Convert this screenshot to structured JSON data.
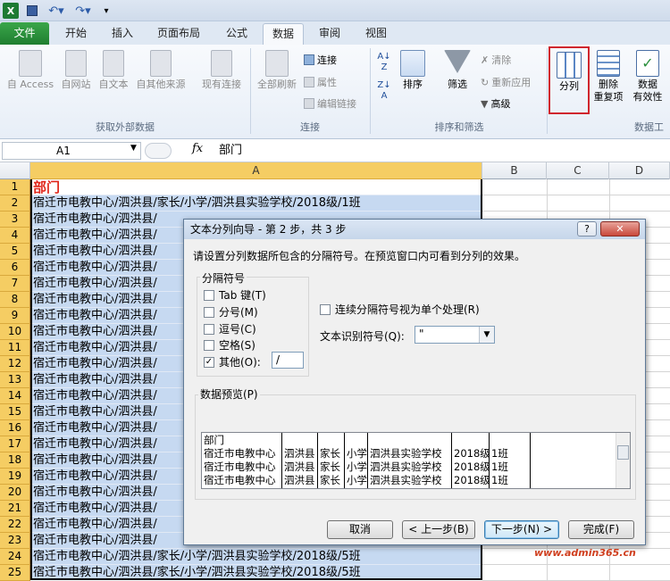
{
  "ribbon": {
    "tabs": [
      {
        "label": "文件"
      },
      {
        "label": "开始"
      },
      {
        "label": "插入"
      },
      {
        "label": "页面布局"
      },
      {
        "label": "公式"
      },
      {
        "label": "数据"
      },
      {
        "label": "审阅"
      },
      {
        "label": "视图"
      }
    ],
    "active_tab": "数据",
    "groups": {
      "external": {
        "label": "获取外部数据",
        "access": "自 Access",
        "web": "自网站",
        "text": "自文本",
        "other": "自其他来源",
        "existing": "现有连接"
      },
      "connections": {
        "label": "连接",
        "refresh_all": "全部刷新",
        "connections": "连接",
        "properties": "属性",
        "edit_links": "编辑链接"
      },
      "sort_filter": {
        "label": "排序和筛选",
        "sort": "排序",
        "filter": "筛选",
        "clear": "清除",
        "reapply": "重新应用",
        "advanced": "高级"
      },
      "data_tools": {
        "label": "数据工",
        "text_to_columns": "分列",
        "remove_dup_1": "删除",
        "remove_dup_2": "重复项",
        "validation_1": "数据",
        "validation_2": "有效性"
      }
    }
  },
  "formula_bar": {
    "name_box": "A1",
    "fx": "fx",
    "content": "部门"
  },
  "columns": [
    "A",
    "B",
    "C",
    "D"
  ],
  "rows": {
    "numbers": [
      "1",
      "2",
      "3",
      "4",
      "5",
      "6",
      "7",
      "8",
      "9",
      "10",
      "11",
      "12",
      "13",
      "14",
      "15",
      "16",
      "17",
      "18",
      "19",
      "20",
      "21",
      "22",
      "23",
      "24",
      "25"
    ],
    "a_values": [
      "部门",
      "宿迁市电教中心/泗洪县/家长/小学/泗洪县实验学校/2018级/1班",
      "宿迁市电教中心/泗洪县/",
      "宿迁市电教中心/泗洪县/",
      "宿迁市电教中心/泗洪县/",
      "宿迁市电教中心/泗洪县/",
      "宿迁市电教中心/泗洪县/",
      "宿迁市电教中心/泗洪县/",
      "宿迁市电教中心/泗洪县/",
      "宿迁市电教中心/泗洪县/",
      "宿迁市电教中心/泗洪县/",
      "宿迁市电教中心/泗洪县/",
      "宿迁市电教中心/泗洪县/",
      "宿迁市电教中心/泗洪县/",
      "宿迁市电教中心/泗洪县/",
      "宿迁市电教中心/泗洪县/",
      "宿迁市电教中心/泗洪县/",
      "宿迁市电教中心/泗洪县/",
      "宿迁市电教中心/泗洪县/",
      "宿迁市电教中心/泗洪县/",
      "宿迁市电教中心/泗洪县/",
      "宿迁市电教中心/泗洪县/",
      "宿迁市电教中心/泗洪县/",
      "宿迁市电教中心/泗洪县/家长/小学/泗洪县实验学校/2018级/5班",
      "宿迁市电教中心/泗洪县/家长/小学/泗洪县实验学校/2018级/5班"
    ]
  },
  "dialog": {
    "title": "文本分列向导 - 第 2 步，共 3 步",
    "help": "?",
    "close": "✕",
    "instruction": "请设置分列数据所包含的分隔符号。在预览窗口内可看到分列的效果。",
    "delimiters_label": "分隔符号",
    "tab": "Tab 键(T)",
    "semicolon": "分号(M)",
    "comma": "逗号(C)",
    "space": "空格(S)",
    "other": "其他(O):",
    "other_value": "/",
    "consecutive": "连续分隔符号视为单个处理(R)",
    "qualifier_label": "文本识别符号(Q):",
    "qualifier_value": "\"",
    "preview_label": "数据预览(P)",
    "preview_rows": [
      [
        "部门",
        "",
        "",
        "",
        "",
        "",
        ""
      ],
      [
        "宿迁市电教中心",
        "泗洪县",
        "家长",
        "小学",
        "泗洪县实验学校",
        "2018级",
        "1班"
      ],
      [
        "宿迁市电教中心",
        "泗洪县",
        "家长",
        "小学",
        "泗洪县实验学校",
        "2018级",
        "1班"
      ],
      [
        "宿迁市电教中心",
        "泗洪县",
        "家长",
        "小学",
        "泗洪县实验学校",
        "2018级",
        "1班"
      ]
    ],
    "buttons": {
      "cancel": "取消",
      "back": "< 上一步(B)",
      "next": "下一步(N) >",
      "finish": "完成(F)"
    }
  },
  "watermark": "www.admin365.cn",
  "colors": {
    "highlight": "#d0262d",
    "selection": "#c6d9f1",
    "row_header": "#f5cd63",
    "file_tab": "#2a8f3c"
  }
}
